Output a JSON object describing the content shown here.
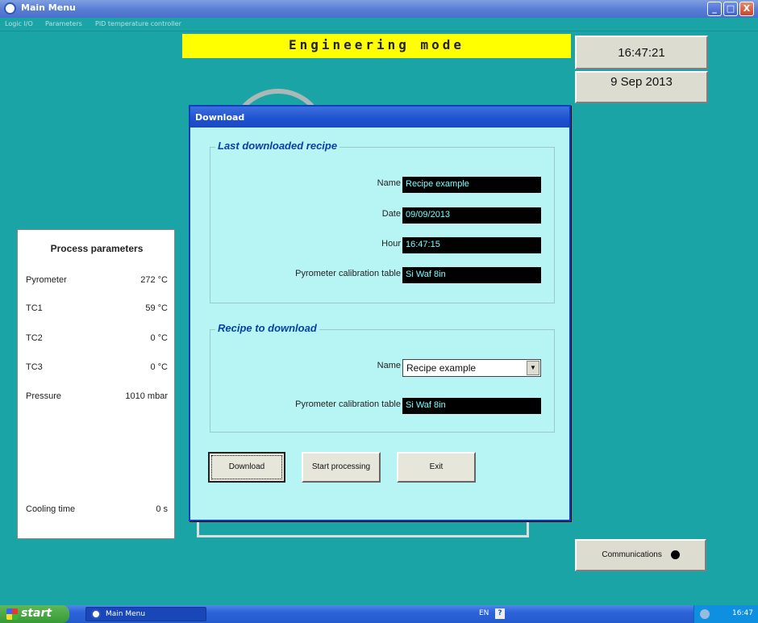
{
  "window": {
    "title": "Main Menu",
    "buttons": {
      "minimize": "_",
      "maximize": "□",
      "close": "X"
    }
  },
  "menu": {
    "items": [
      "Logic I/O",
      "Parameters",
      "PID temperature controller"
    ]
  },
  "banner": {
    "text": "Engineering mode"
  },
  "clock": {
    "time": "16:47:21",
    "date": "9 Sep 2013"
  },
  "process_parameters": {
    "title": "Process parameters",
    "rows": [
      {
        "label": "Pyrometer",
        "value": "272 °C"
      },
      {
        "label": "TC1",
        "value": "59 °C"
      },
      {
        "label": "TC2",
        "value": "0 °C"
      },
      {
        "label": "TC3",
        "value": "0 °C"
      },
      {
        "label": "Pressure",
        "value": "1010 mbar"
      }
    ],
    "cooling_time": {
      "label": "Cooling time",
      "value": "0 s"
    }
  },
  "dialog": {
    "title": "Download",
    "last_downloaded": {
      "heading": "Last downloaded recipe",
      "name_label": "Name",
      "name_value": "Recipe example",
      "date_label": "Date",
      "date_value": "09/09/2013",
      "hour_label": "Hour",
      "hour_value": "16:47:15",
      "pyro_label": "Pyrometer calibration table",
      "pyro_value": "Si Waf 8in"
    },
    "to_download": {
      "heading": "Recipe to download",
      "name_label": "Name",
      "name_selected": "Recipe example",
      "pyro_label": "Pyrometer calibration table",
      "pyro_value": "Si Waf 8in"
    },
    "buttons": {
      "download": "Download",
      "start_processing": "Start processing",
      "exit": "Exit"
    }
  },
  "communications": {
    "label": "Communications"
  },
  "taskbar": {
    "start": "start",
    "task": "Main Menu",
    "language": "EN",
    "clock": "16:47"
  }
}
